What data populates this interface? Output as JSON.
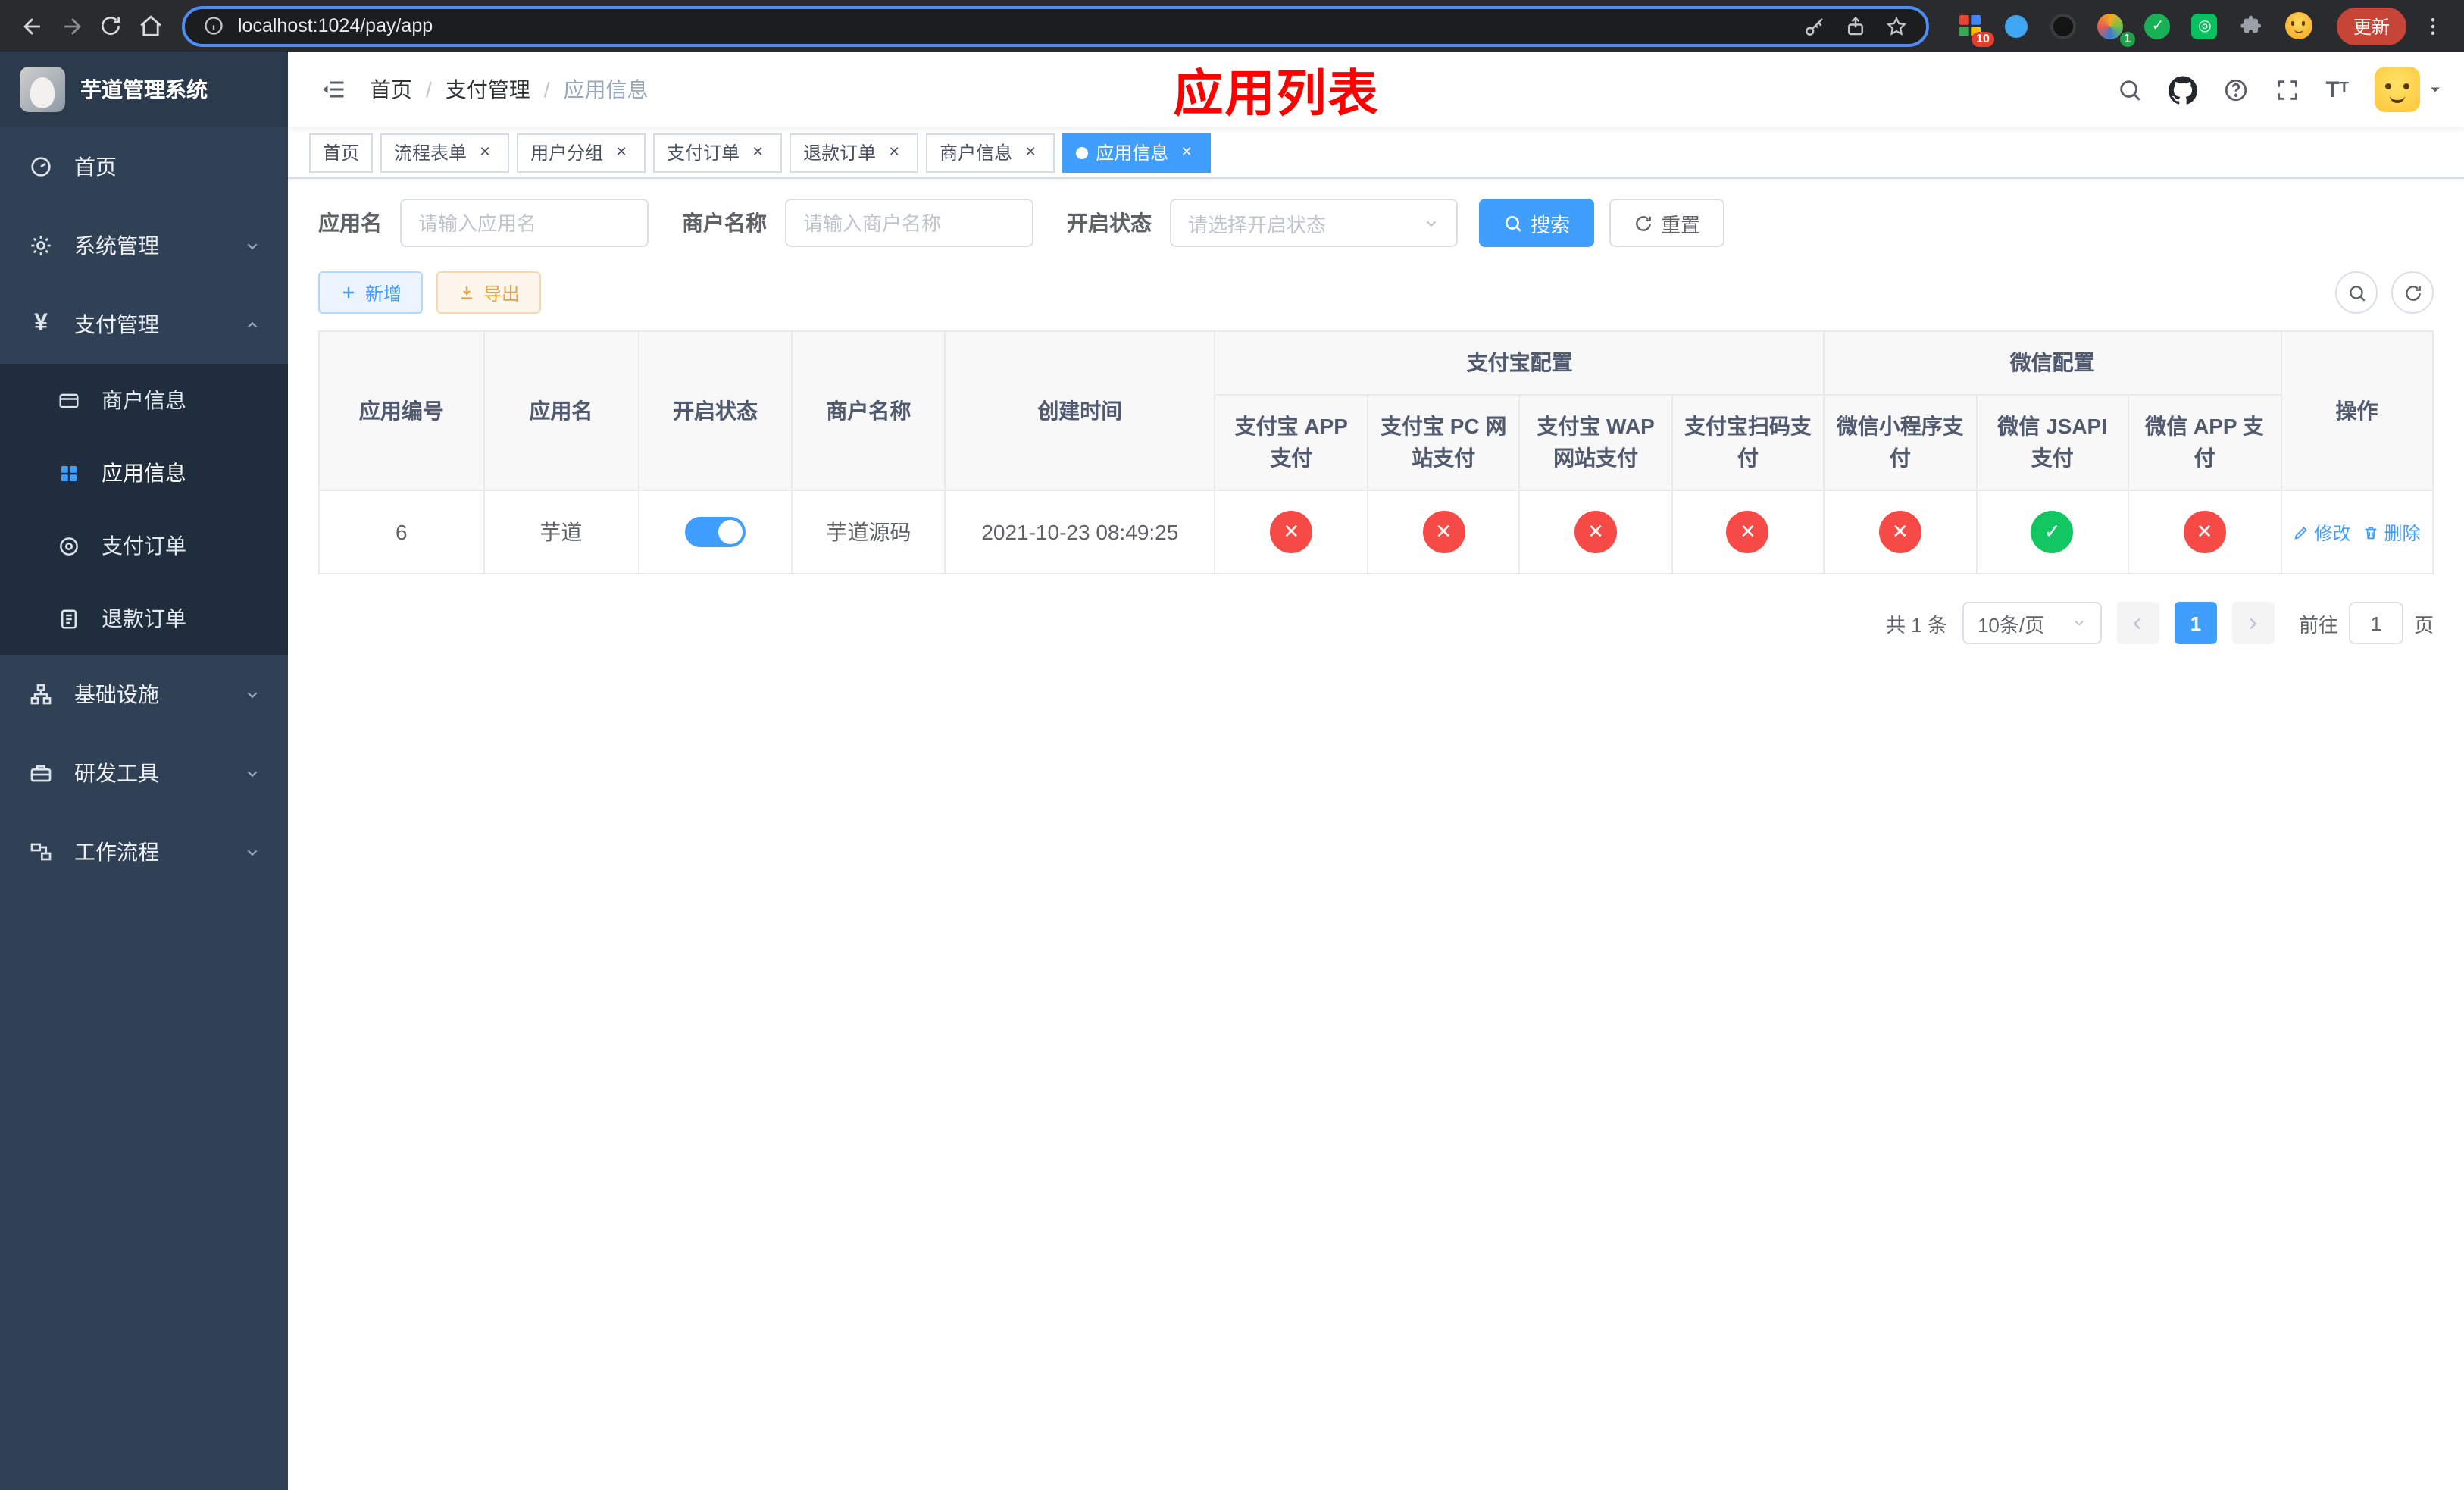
{
  "colors": {
    "accent": "#409eff",
    "danger": "#f54a45",
    "success": "#12c662",
    "warning": "#e6a23c",
    "title": "#ff0000",
    "sidebar": "#304156",
    "submenu": "#1f2d3d"
  },
  "browser": {
    "url": "localhost:1024/pay/app",
    "update_label": "更新",
    "ext_badge_grid": "10",
    "ext_badge_avatar": "1"
  },
  "sidebar": {
    "title": "芋道管理系统",
    "items": [
      {
        "label": "首页"
      },
      {
        "label": "系统管理"
      },
      {
        "label": "支付管理",
        "children": [
          {
            "label": "商户信息"
          },
          {
            "label": "应用信息"
          },
          {
            "label": "支付订单"
          },
          {
            "label": "退款订单"
          }
        ]
      },
      {
        "label": "基础设施"
      },
      {
        "label": "研发工具"
      },
      {
        "label": "工作流程"
      }
    ]
  },
  "navbar": {
    "breadcrumb": [
      "首页",
      "支付管理",
      "应用信息"
    ],
    "page_title": "应用列表"
  },
  "tabs": [
    {
      "label": "首页"
    },
    {
      "label": "流程表单"
    },
    {
      "label": "用户分组"
    },
    {
      "label": "支付订单"
    },
    {
      "label": "退款订单"
    },
    {
      "label": "商户信息"
    },
    {
      "label": "应用信息"
    }
  ],
  "filters": {
    "app_name_label": "应用名",
    "app_name_placeholder": "请输入应用名",
    "merchant_label": "商户名称",
    "merchant_placeholder": "请输入商户名称",
    "status_label": "开启状态",
    "status_placeholder": "请选择开启状态",
    "search_label": "搜索",
    "reset_label": "重置"
  },
  "toolbar": {
    "add_label": "新增",
    "export_label": "导出"
  },
  "table": {
    "groups": {
      "alipay": "支付宝配置",
      "wechat": "微信配置"
    },
    "columns": {
      "id": "应用编号",
      "name": "应用名",
      "status": "开启状态",
      "merchant": "商户名称",
      "created": "创建时间",
      "alipay_app": "支付宝 APP 支付",
      "alipay_pc": "支付宝 PC 网站支付",
      "alipay_wap": "支付宝 WAP 网站支付",
      "alipay_qr": "支付宝扫码支付",
      "wx_mini": "微信小程序支付",
      "wx_jsapi": "微信 JSAPI 支付",
      "wx_app": "微信 APP 支付",
      "actions": "操作"
    },
    "rows": [
      {
        "id": "6",
        "name": "芋道",
        "enabled": true,
        "merchant": "芋道源码",
        "created": "2021-10-23 08:49:25",
        "alipay_app": false,
        "alipay_pc": false,
        "alipay_wap": false,
        "alipay_qr": false,
        "wx_mini": false,
        "wx_jsapi": true,
        "wx_app": false,
        "edit_label": "修改",
        "delete_label": "删除"
      }
    ]
  },
  "pagination": {
    "total": "共 1 条",
    "page_size": "10条/页",
    "page": "1",
    "goto": "前往",
    "goto_value": "1",
    "unit": "页"
  }
}
